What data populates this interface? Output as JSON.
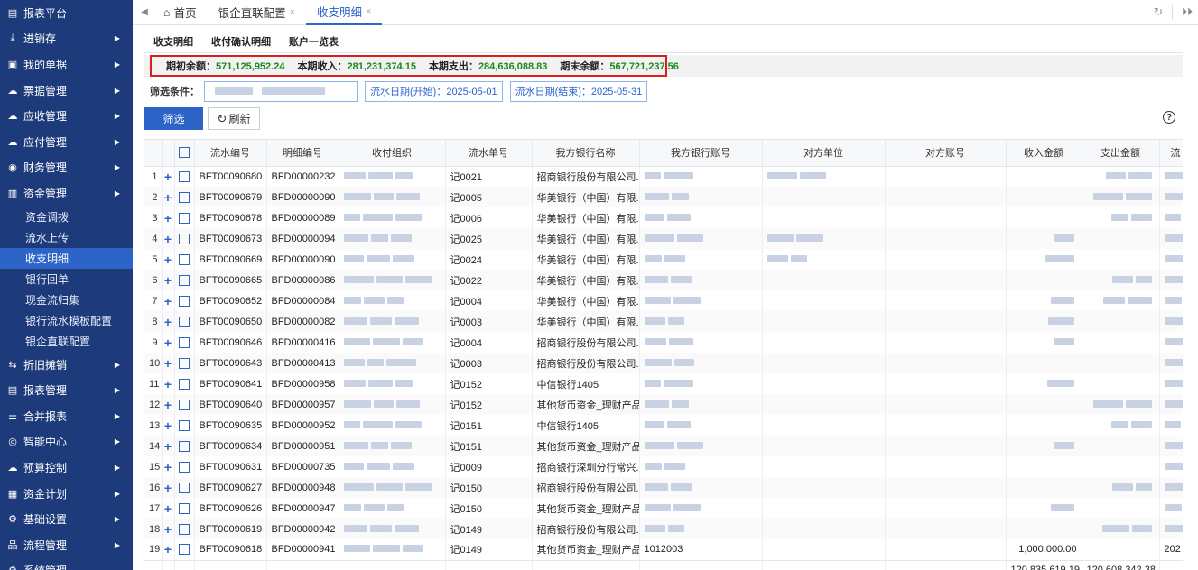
{
  "sidebar": {
    "items": [
      {
        "label": "报表平台",
        "icon": "report-icon",
        "glyph": "▤",
        "arrow": false
      },
      {
        "label": "进销存",
        "icon": "download-tray-icon",
        "glyph": "⤓",
        "arrow": true
      },
      {
        "label": "我的单据",
        "icon": "document-icon",
        "glyph": "▣",
        "arrow": true
      },
      {
        "label": "票据管理",
        "icon": "cloud-icon",
        "glyph": "☁",
        "arrow": true
      },
      {
        "label": "应收管理",
        "icon": "cloud-icon",
        "glyph": "☁",
        "arrow": true
      },
      {
        "label": "应付管理",
        "icon": "cloud-icon",
        "glyph": "☁",
        "arrow": true
      },
      {
        "label": "财务管理",
        "icon": "finance-icon",
        "glyph": "◉",
        "arrow": true
      },
      {
        "label": "资金管理",
        "icon": "bar-chart-icon",
        "glyph": "▥",
        "arrow": true
      }
    ],
    "subitems": [
      {
        "label": "资金调拨",
        "active": false
      },
      {
        "label": "流水上传",
        "active": false
      },
      {
        "label": "收支明细",
        "active": true
      },
      {
        "label": "银行回单",
        "active": false
      },
      {
        "label": "现金流归集",
        "active": false
      },
      {
        "label": "银行流水模板配置",
        "active": false
      },
      {
        "label": "银企直联配置",
        "active": false
      }
    ],
    "items_after": [
      {
        "label": "折旧摊销",
        "icon": "swap-icon",
        "glyph": "⇆",
        "arrow": true
      },
      {
        "label": "报表管理",
        "icon": "report-icon",
        "glyph": "▤",
        "arrow": true
      },
      {
        "label": "合并报表",
        "icon": "merge-icon",
        "glyph": "⚌",
        "arrow": true
      },
      {
        "label": "智能中心",
        "icon": "smart-icon",
        "glyph": "◎",
        "arrow": true
      },
      {
        "label": "预算控制",
        "icon": "cloud-icon",
        "glyph": "☁",
        "arrow": true
      },
      {
        "label": "资金计划",
        "icon": "plan-icon",
        "glyph": "▦",
        "arrow": true
      },
      {
        "label": "基础设置",
        "icon": "gear-icon",
        "glyph": "⚙",
        "arrow": true
      },
      {
        "label": "流程管理",
        "icon": "flow-icon",
        "glyph": "品",
        "arrow": true
      },
      {
        "label": "系统管理",
        "icon": "system-icon",
        "glyph": "⚙",
        "arrow": false
      }
    ]
  },
  "topbar": {
    "tabs": [
      {
        "label": "首页",
        "icon": "home-icon",
        "closable": false,
        "active": false
      },
      {
        "label": "银企直联配置",
        "closable": true,
        "active": false
      },
      {
        "label": "收支明细",
        "closable": true,
        "active": true
      }
    ],
    "close_glyph": "×"
  },
  "subtabs": [
    "收支明细",
    "收付确认明细",
    "账户一览表"
  ],
  "summary": {
    "opening_label": "期初余额：",
    "opening_value": "571,125,952.24",
    "income_label": "本期收入：",
    "income_value": "281,231,374.15",
    "expense_label": "本期支出：",
    "expense_value": "284,636,088.83",
    "closing_label": "期末余额：",
    "closing_value": "567,721,237.56"
  },
  "filter": {
    "label": "筛选条件：",
    "date_start": "流水日期(开始)：2025-05-01",
    "date_end": "流水日期(结束)：2025-05-31"
  },
  "actions": {
    "filter_button": "筛选",
    "refresh_button": "刷新",
    "help": "?"
  },
  "table": {
    "columns": [
      "流水编号",
      "明细编号",
      "收付组织",
      "流水单号",
      "我方银行名称",
      "我方银行账号",
      "对方单位",
      "对方账号",
      "收入金额",
      "支出金额",
      "流"
    ],
    "rows": [
      {
        "idx": "1",
        "flow": "BFT00090680",
        "detail": "BFD00000232",
        "voucher": "记0021",
        "bank": "招商银行股份有限公司...",
        "account": "",
        "income": "",
        "expense": ""
      },
      {
        "idx": "2",
        "flow": "BFT00090679",
        "detail": "BFD00000090",
        "voucher": "记0005",
        "bank": "华美银行（中国）有限...",
        "account": "",
        "income": "",
        "expense": ""
      },
      {
        "idx": "3",
        "flow": "BFT00090678",
        "detail": "BFD00000089",
        "voucher": "记0006",
        "bank": "华美银行（中国）有限...",
        "account": "",
        "income": "",
        "expense": ""
      },
      {
        "idx": "4",
        "flow": "BFT00090673",
        "detail": "BFD00000094",
        "voucher": "记0025",
        "bank": "华美银行（中国）有限...",
        "account": "",
        "income": "",
        "expense": ""
      },
      {
        "idx": "5",
        "flow": "BFT00090669",
        "detail": "BFD00000090",
        "voucher": "记0024",
        "bank": "华美银行（中国）有限...",
        "account": "",
        "income": "",
        "expense": ""
      },
      {
        "idx": "6",
        "flow": "BFT00090665",
        "detail": "BFD00000086",
        "voucher": "记0022",
        "bank": "华美银行（中国）有限...",
        "account": "",
        "income": "",
        "expense": ""
      },
      {
        "idx": "7",
        "flow": "BFT00090652",
        "detail": "BFD00000084",
        "voucher": "记0004",
        "bank": "华美银行（中国）有限...",
        "account": "",
        "income": "",
        "expense": ""
      },
      {
        "idx": "8",
        "flow": "BFT00090650",
        "detail": "BFD00000082",
        "voucher": "记0003",
        "bank": "华美银行（中国）有限...",
        "account": "",
        "income": "",
        "expense": ""
      },
      {
        "idx": "9",
        "flow": "BFT00090646",
        "detail": "BFD00000416",
        "voucher": "记0004",
        "bank": "招商银行股份有限公司...",
        "account": "",
        "income": "",
        "expense": ""
      },
      {
        "idx": "10",
        "flow": "BFT00090643",
        "detail": "BFD00000413",
        "voucher": "记0003",
        "bank": "招商银行股份有限公司...",
        "account": "",
        "income": "",
        "expense": ""
      },
      {
        "idx": "11",
        "flow": "BFT00090641",
        "detail": "BFD00000958",
        "voucher": "记0152",
        "bank": "中信银行1405",
        "account": "",
        "income": "",
        "expense": ""
      },
      {
        "idx": "12",
        "flow": "BFT00090640",
        "detail": "BFD00000957",
        "voucher": "记0152",
        "bank": "其他货币资金_理财产品",
        "account": "",
        "income": "",
        "expense": ""
      },
      {
        "idx": "13",
        "flow": "BFT00090635",
        "detail": "BFD00000952",
        "voucher": "记0151",
        "bank": "中信银行1405",
        "account": "",
        "income": "",
        "expense": ""
      },
      {
        "idx": "14",
        "flow": "BFT00090634",
        "detail": "BFD00000951",
        "voucher": "记0151",
        "bank": "其他货币资金_理财产品",
        "account": "",
        "income": "",
        "expense": ""
      },
      {
        "idx": "15",
        "flow": "BFT00090631",
        "detail": "BFD00000735",
        "voucher": "记0009",
        "bank": "招商银行深圳分行常兴...",
        "account": "",
        "income": "",
        "expense": ""
      },
      {
        "idx": "16",
        "flow": "BFT00090627",
        "detail": "BFD00000948",
        "voucher": "记0150",
        "bank": "招商银行股份有限公司...",
        "account": "",
        "income": "",
        "expense": ""
      },
      {
        "idx": "17",
        "flow": "BFT00090626",
        "detail": "BFD00000947",
        "voucher": "记0150",
        "bank": "其他货币资金_理财产品",
        "account": "",
        "income": "",
        "expense": ""
      },
      {
        "idx": "18",
        "flow": "BFT00090619",
        "detail": "BFD00000942",
        "voucher": "记0149",
        "bank": "招商银行股份有限公司...",
        "account": "",
        "income": "",
        "expense": ""
      },
      {
        "idx": "19",
        "flow": "BFT00090618",
        "detail": "BFD00000941",
        "voucher": "记0149",
        "bank": "其他货币资金_理财产品",
        "account": "1012003",
        "income": "1,000,000.00",
        "expense": "",
        "flow_tail": "202"
      }
    ],
    "total_income": "120,835,619.19",
    "total_expense": "120,608,342.38"
  }
}
